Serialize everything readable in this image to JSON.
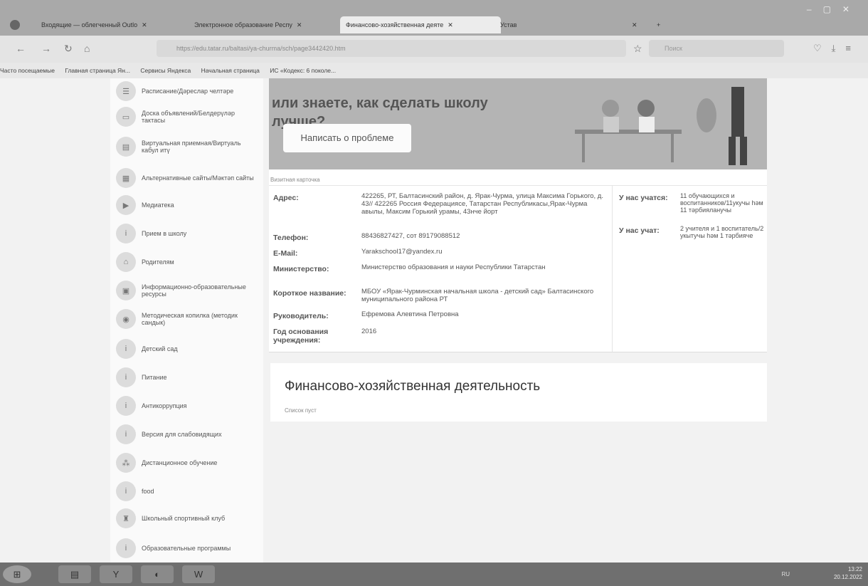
{
  "browser": {
    "tabs": [
      {
        "label": "Входящие — облегченный Outlo"
      },
      {
        "label": "Электронное образование Респу"
      },
      {
        "label": "Финансово-хозяйственная деяте"
      },
      {
        "label": "Устав"
      }
    ],
    "url": "https://edu.tatar.ru/baltasi/ya-churma/sch/page3442420.htm",
    "search_placeholder": "Поиск",
    "bookmarks": [
      "Часто посещаемые",
      "Главная страница Ян...",
      "Сервисы Яндекса",
      "Начальная страница",
      "ИС «Кодекс: 6 поколе..."
    ]
  },
  "banner": {
    "title": "или знаете, как сделать школу лучше?",
    "button": "Написать о проблеме"
  },
  "sidebar": {
    "items": [
      {
        "label": "Расписание/Дәреслар челтәре",
        "icon": "schedule-icon"
      },
      {
        "label": "Доска объявлений/Белдерүләр тактасы",
        "icon": "board-icon"
      },
      {
        "label": "Виртуальная приемная/Виртуаль кабул итү",
        "icon": "reception-icon"
      },
      {
        "label": "Альтернативные сайты/Мәктәп сайты",
        "icon": "sites-icon"
      },
      {
        "label": "Медиатека",
        "icon": "play-icon"
      },
      {
        "label": "Прием в школу",
        "icon": "info-icon"
      },
      {
        "label": "Родителям",
        "icon": "building-icon"
      },
      {
        "label": "Информационно-образовательные ресурсы",
        "icon": "resources-icon"
      },
      {
        "label": "Методическая копилка (методик сандык)",
        "icon": "piggy-icon"
      },
      {
        "label": "Детский сад",
        "icon": "info-icon"
      },
      {
        "label": "Питание",
        "icon": "info-icon"
      },
      {
        "label": "Антикоррупция",
        "icon": "info-icon"
      },
      {
        "label": "Версия для слабовидящих",
        "icon": "info-icon"
      },
      {
        "label": "Дистанционное обучение",
        "icon": "network-icon"
      },
      {
        "label": "food",
        "icon": "info-icon"
      },
      {
        "label": "Школьный спортивный клуб",
        "icon": "trophy-icon"
      },
      {
        "label": "Образовательные программы",
        "icon": "info-icon"
      }
    ]
  },
  "card": {
    "title": "Визитная карточка",
    "address_label": "Адрес:",
    "address": "422265, РТ, Балтасинский район, д. Ярак-Чурма, улица Максима Горького, д. 43// 422265 Россия Федерациясе, Татарстан Республикасы,Ярак-Чурма авылы, Максим Горький урамы, 43нче йорт",
    "phone_label": "Телефон:",
    "phone": "88436827427, сот 89179088512",
    "email_label": "E-Mail:",
    "email": "Yarakschool17@yandex.ru",
    "ministry_label": "Министерство:",
    "ministry": "Министерство образования и науки Республики Татарстан",
    "short_label": "Короткое название:",
    "short": "МБОУ «Ярак-Чурминская начальная школа - детский сад» Балтасинского муниципального района РТ",
    "head_label": "Руководитель:",
    "head": "Ефремова Алевтина Петровна",
    "year_label": "Год основания учреждения:",
    "year": "2016",
    "students_label": "У нас учатся:",
    "students": "11 обучающихся и воспитанников/11укучы hәм 11 тәрбияланучы",
    "teachers_label": "У нас учат:",
    "teachers": "2 учителя и 1 воспитатель/2 укытучы hәм 1 тәрбияче"
  },
  "finance": {
    "title": "Финансово-хозяйственная деятельность",
    "empty": "Список пуст"
  },
  "taskbar": {
    "lang": "RU",
    "time": "13:22",
    "date": "20.12.2022"
  }
}
